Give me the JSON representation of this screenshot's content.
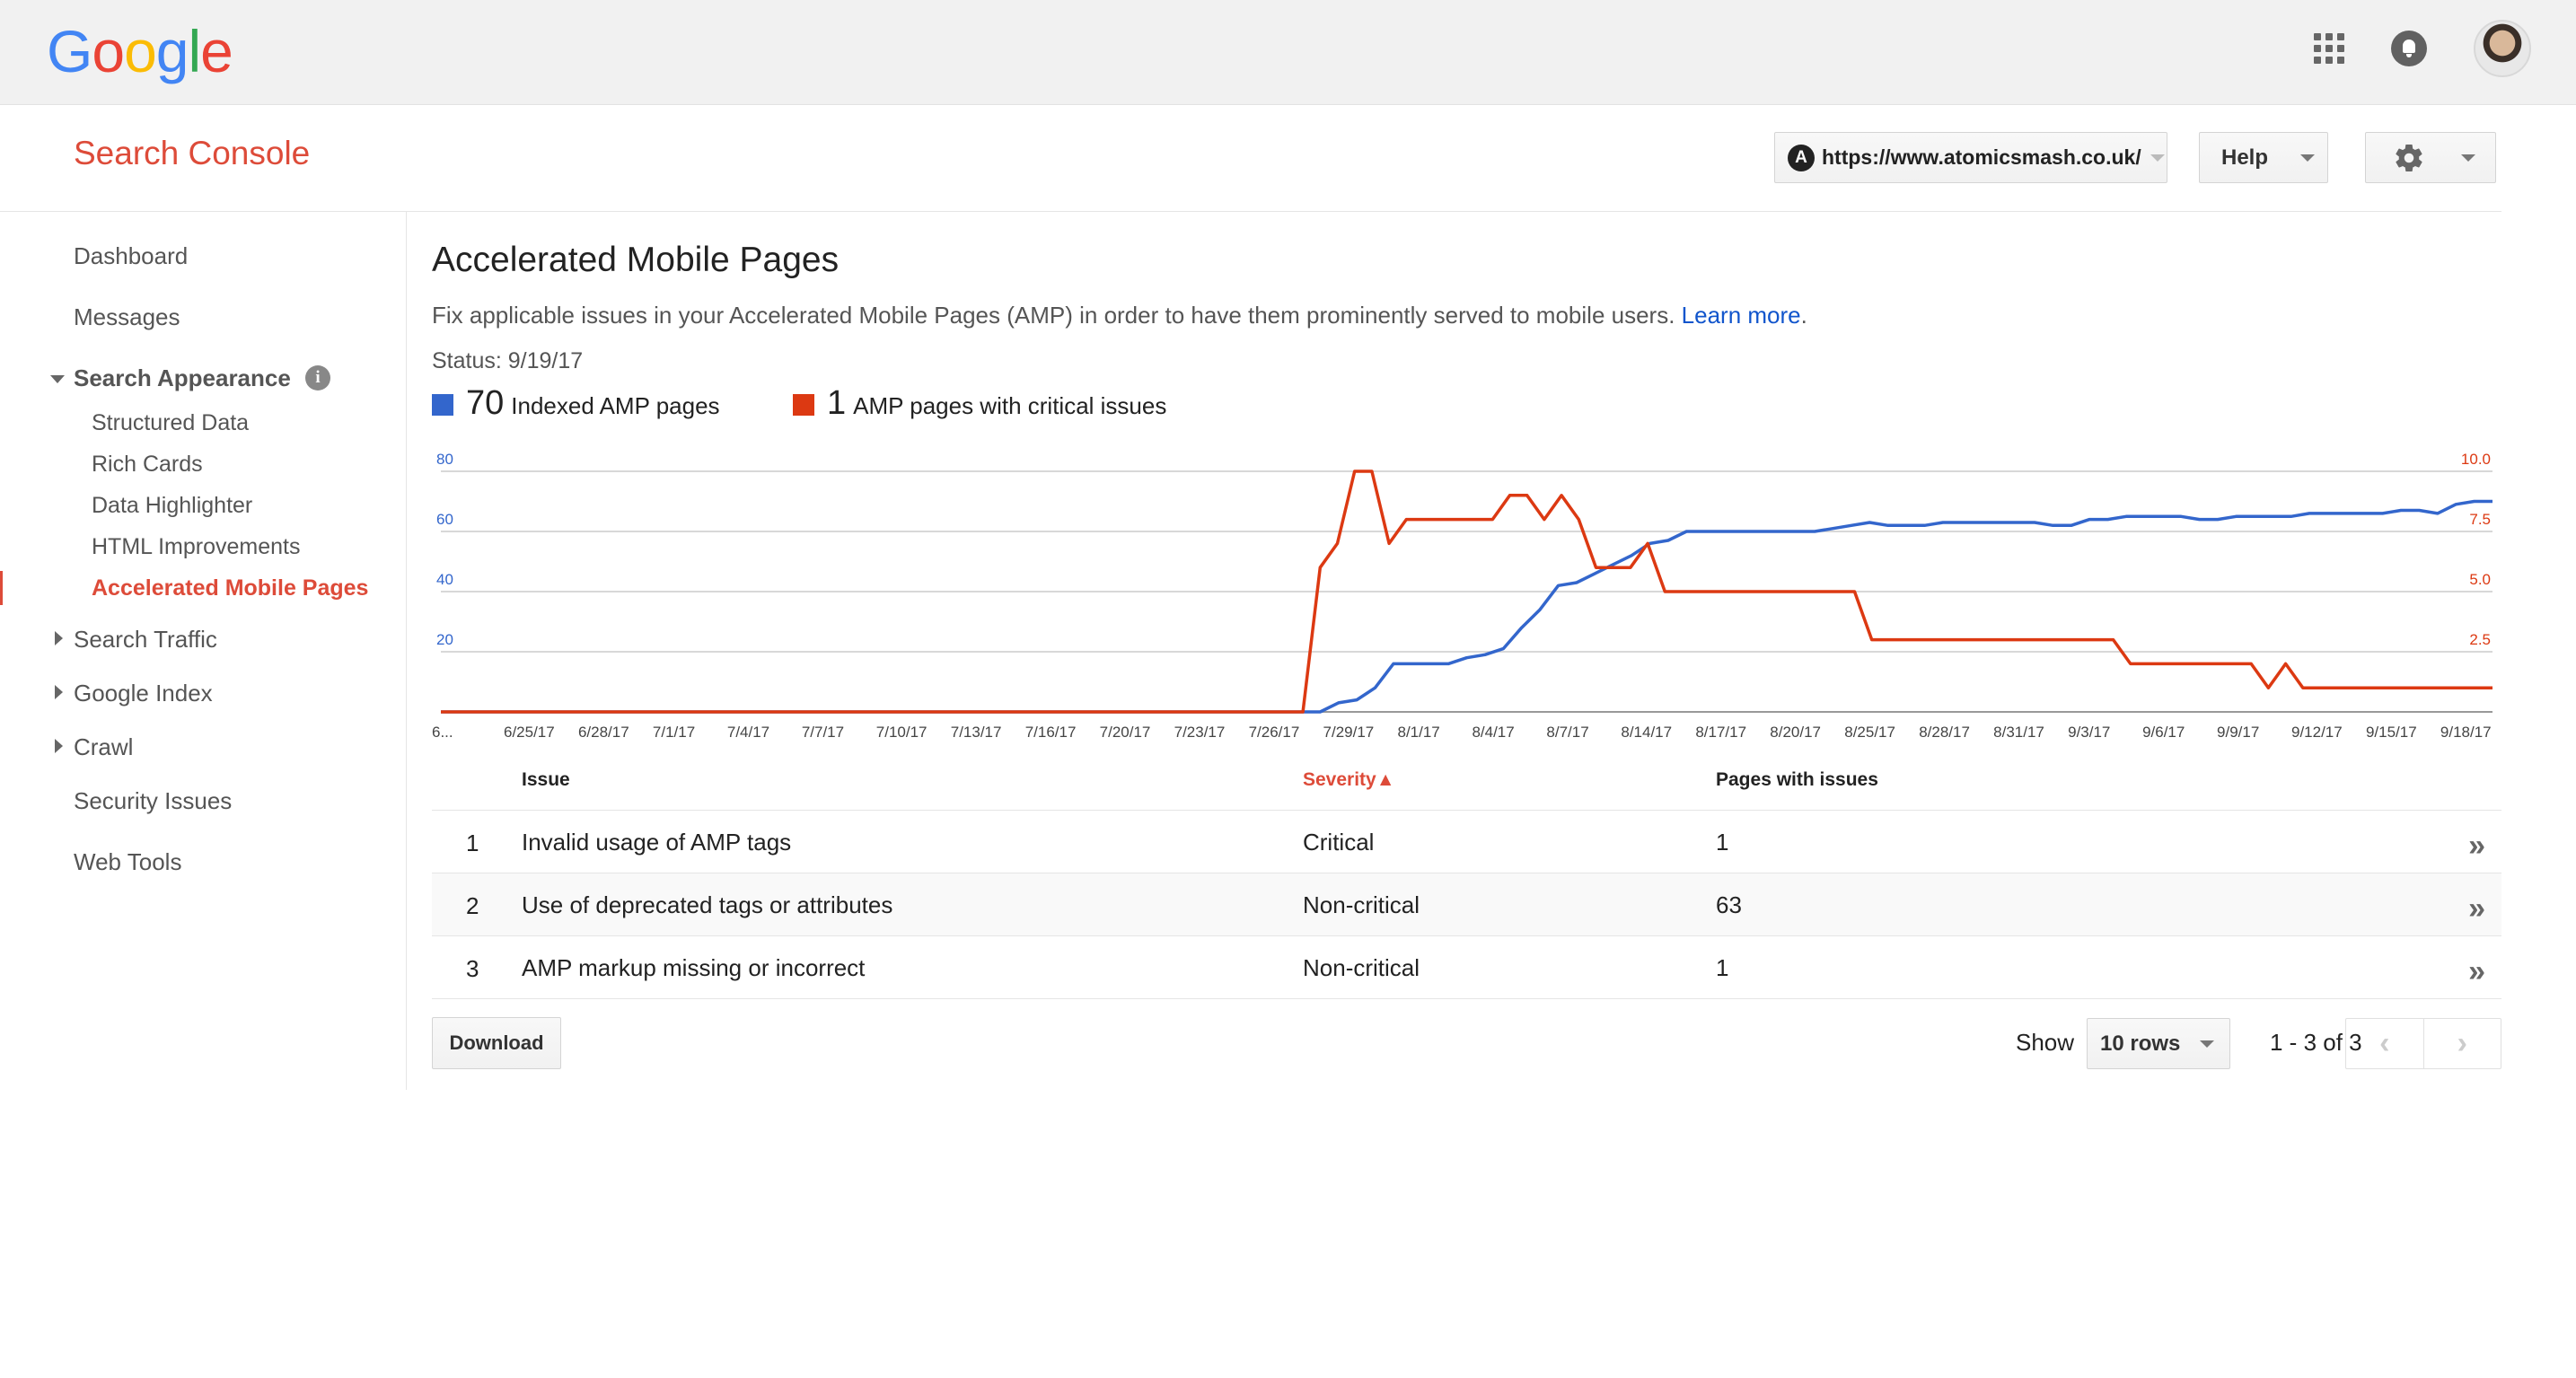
{
  "topbar": {
    "logo_letters": [
      {
        "ch": "G",
        "color": "#4285f4"
      },
      {
        "ch": "o",
        "color": "#ea4335"
      },
      {
        "ch": "o",
        "color": "#fbbc05"
      },
      {
        "ch": "g",
        "color": "#4285f4"
      },
      {
        "ch": "l",
        "color": "#34a853"
      },
      {
        "ch": "e",
        "color": "#ea4335"
      }
    ],
    "icons": [
      "apps-grid-icon",
      "notifications-bell-icon",
      "account-avatar"
    ]
  },
  "header": {
    "product_title": "Search Console",
    "property_icon_letter": "A",
    "property_url": "https://www.atomicsmash.co.uk/",
    "help_label": "Help"
  },
  "sidebar": {
    "dashboard": "Dashboard",
    "messages": "Messages",
    "search_appearance": "Search Appearance",
    "info_glyph": "i",
    "structured_data": "Structured Data",
    "rich_cards": "Rich Cards",
    "data_highlighter": "Data Highlighter",
    "html_improvements": "HTML Improvements",
    "amp": "Accelerated Mobile Pages",
    "search_traffic": "Search Traffic",
    "google_index": "Google Index",
    "crawl": "Crawl",
    "security_issues": "Security Issues",
    "web_tools": "Web Tools"
  },
  "main": {
    "title": "Accelerated Mobile Pages",
    "description": "Fix applicable issues in your Accelerated Mobile Pages (AMP) in order to have them prominently served to mobile users.",
    "learn_more": "Learn more",
    "learn_more_suffix": ".",
    "status": "Status: 9/19/17",
    "legend": [
      {
        "value": "70",
        "label": "Indexed AMP pages",
        "color": "#3366cc"
      },
      {
        "value": "1",
        "label": "AMP pages with critical issues",
        "color": "#dc3912"
      }
    ]
  },
  "chart_data": {
    "type": "line",
    "x_tick_labels": [
      "6...",
      "6/25/17",
      "6/28/17",
      "7/1/17",
      "7/4/17",
      "7/7/17",
      "7/10/17",
      "7/13/17",
      "7/16/17",
      "7/20/17",
      "7/23/17",
      "7/26/17",
      "7/29/17",
      "8/1/17",
      "8/4/17",
      "8/7/17",
      "8/14/17",
      "8/17/17",
      "8/20/17",
      "8/25/17",
      "8/28/17",
      "8/31/17",
      "9/3/17",
      "9/6/17",
      "9/9/17",
      "9/12/17",
      "9/15/17",
      "9/18/17"
    ],
    "left_axis": {
      "ticks": [
        "80",
        "60",
        "40",
        "20"
      ],
      "ylim": [
        0,
        80
      ],
      "color": "#3366cc"
    },
    "right_axis": {
      "ticks": [
        "10.0",
        "7.5",
        "5.0",
        "2.5"
      ],
      "ylim": [
        0,
        10
      ],
      "color": "#dc3912"
    },
    "grid": true,
    "series": [
      {
        "name": "Indexed AMP pages",
        "color": "#3366cc",
        "axis": "left",
        "values": [
          0,
          0,
          0,
          0,
          0,
          0,
          0,
          0,
          0,
          0,
          0,
          0,
          0,
          0,
          0,
          0,
          0,
          0,
          0,
          0,
          0,
          0,
          0,
          0,
          0,
          0,
          0,
          0,
          0,
          0,
          0,
          0,
          0,
          0,
          0,
          0,
          0,
          0,
          0,
          0,
          0,
          0,
          0,
          0,
          0,
          0,
          0,
          0,
          0,
          3,
          4,
          8,
          16,
          16,
          16,
          16,
          18,
          19,
          21,
          28,
          34,
          42,
          43,
          46,
          49,
          52,
          56,
          57,
          60,
          60,
          60,
          60,
          60,
          60,
          60,
          60,
          61,
          62,
          63,
          62,
          62,
          62,
          63,
          63,
          63,
          63,
          63,
          63,
          62,
          62,
          64,
          64,
          65,
          65,
          65,
          65,
          64,
          64,
          65,
          65,
          65,
          65,
          66,
          66,
          66,
          66,
          66,
          67,
          67,
          66,
          69,
          70,
          70
        ]
      },
      {
        "name": "AMP pages with critical issues",
        "color": "#dc3912",
        "axis": "left_scaled",
        "values": [
          0,
          0,
          0,
          0,
          0,
          0,
          0,
          0,
          0,
          0,
          0,
          0,
          0,
          0,
          0,
          0,
          0,
          0,
          0,
          0,
          0,
          0,
          0,
          0,
          0,
          0,
          0,
          0,
          0,
          0,
          0,
          0,
          0,
          0,
          0,
          0,
          0,
          0,
          0,
          0,
          0,
          0,
          0,
          0,
          0,
          0,
          0,
          0,
          0,
          0,
          0,
          6.0,
          7.0,
          10.0,
          10.0,
          7.0,
          8.0,
          8.0,
          8.0,
          8.0,
          8.0,
          8.0,
          9.0,
          9.0,
          8.0,
          9.0,
          8.0,
          6.0,
          6.0,
          6.0,
          7.0,
          5.0,
          5.0,
          5.0,
          5.0,
          5.0,
          5.0,
          5.0,
          5.0,
          5.0,
          5.0,
          5.0,
          5.0,
          3.0,
          3.0,
          3.0,
          3.0,
          3.0,
          3.0,
          3.0,
          3.0,
          3.0,
          3.0,
          3.0,
          3.0,
          3.0,
          3.0,
          3.0,
          2.0,
          2.0,
          2.0,
          2.0,
          2.0,
          2.0,
          2.0,
          2.0,
          1.0,
          2.0,
          1.0,
          1.0,
          1.0,
          1.0,
          1.0,
          1.0,
          1.0,
          1.0,
          1.0,
          1.0,
          1.0,
          1.0
        ]
      }
    ]
  },
  "table": {
    "headers": {
      "issue": "Issue",
      "severity": "Severity▲",
      "pages": "Pages with issues"
    },
    "rows": [
      {
        "n": "1",
        "issue": "Invalid usage of AMP tags",
        "severity": "Critical",
        "pages": "1"
      },
      {
        "n": "2",
        "issue": "Use of deprecated tags or attributes",
        "severity": "Non-critical",
        "pages": "63"
      },
      {
        "n": "3",
        "issue": "AMP markup missing or incorrect",
        "severity": "Non-critical",
        "pages": "1"
      }
    ],
    "row_action_glyph": "»"
  },
  "footer": {
    "download_label": "Download",
    "show_label": "Show",
    "rows_option": "10 rows",
    "range": "1 - 3 of 3",
    "prev_glyph": "‹",
    "next_glyph": "›"
  }
}
